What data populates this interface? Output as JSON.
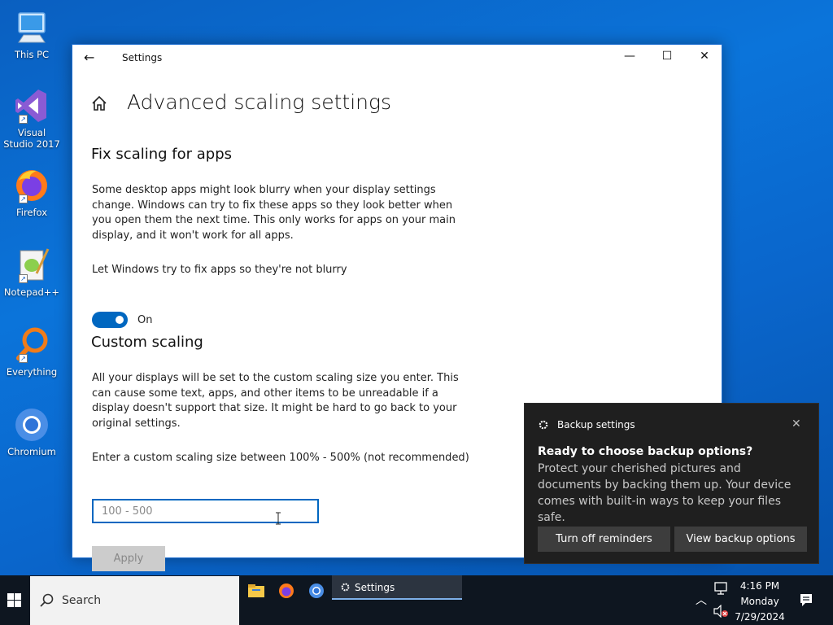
{
  "desktop": {
    "icons": [
      {
        "label": "This PC"
      },
      {
        "label": "Visual Studio 2017"
      },
      {
        "label": "Firefox"
      },
      {
        "label": "Notepad++"
      },
      {
        "label": "Everything"
      },
      {
        "label": "Chromium"
      }
    ]
  },
  "window": {
    "title": "Settings",
    "page_title": "Advanced scaling settings",
    "fix_section": {
      "heading": "Fix scaling for apps",
      "description": "Some desktop apps might look blurry when your display settings change. Windows can try to fix these apps so they look better when you open them the next time. This only works for apps on your main display, and it won't work for all apps.",
      "toggle_label": "Let Windows try to fix apps so they're not blurry",
      "toggle_state": "On"
    },
    "custom_section": {
      "heading": "Custom scaling",
      "description": "All your displays will be set to the custom scaling size you enter. This can cause some text, apps, and other items to be unreadable if a display doesn't support that size. It might be hard to go back to your original settings.",
      "input_label": "Enter a custom scaling size between 100% - 500% (not recommended)",
      "input_placeholder": "100 - 500",
      "input_value": "",
      "apply_label": "Apply"
    }
  },
  "toast": {
    "app_name": "Backup settings",
    "heading": "Ready to choose backup options?",
    "body": "Protect your cherished pictures and documents by backing them up. Your device comes with built-in ways to keep your files safe.",
    "button1": "Turn off reminders",
    "button2": "View backup options"
  },
  "taskbar": {
    "search_label": "Search",
    "active_app": "Settings",
    "time": "4:16 PM",
    "day": "Monday",
    "date": "7/29/2024"
  },
  "colors": {
    "accent": "#0067c0",
    "desktop": "#0b74da",
    "taskbar": "#0e1620",
    "toast_bg": "#1f1f1f"
  }
}
